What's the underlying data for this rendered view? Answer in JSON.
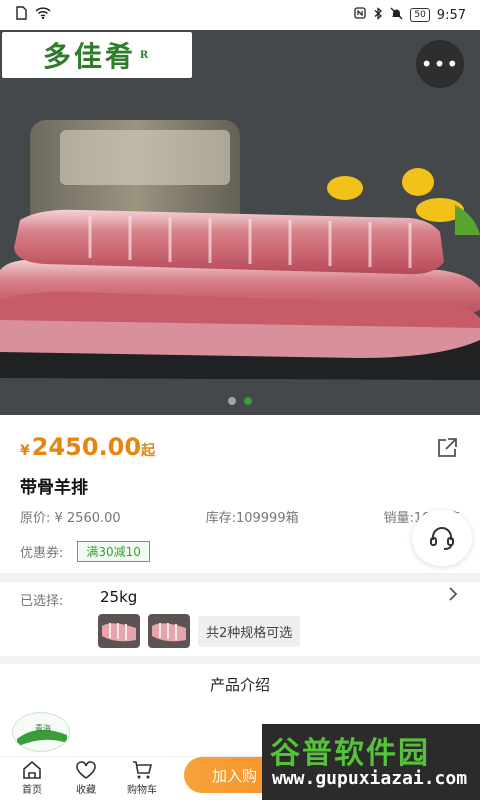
{
  "status_bar": {
    "time": "9:57",
    "battery": "50",
    "icons": [
      "sim-icon",
      "wifi-icon",
      "nfc-icon",
      "bluetooth-icon",
      "mute-icon"
    ]
  },
  "hero": {
    "logo_text": "多佳肴",
    "logo_mark": "R",
    "dots": 2,
    "active_dot": 1
  },
  "product": {
    "currency": "¥",
    "price": "2450.00",
    "price_suffix": "起",
    "title": "带骨羊排",
    "original_price": "原价: ¥ 2560.00",
    "stock": "库存:109999箱",
    "sales": "销量:1001箱",
    "coupon_label": "优惠券:",
    "coupon": "满30减10"
  },
  "selection": {
    "label": "已选择:",
    "value": "25kg",
    "spec_chip": "共2种规格可选"
  },
  "intro": {
    "title": "产品介绍",
    "logo_text": "青海"
  },
  "bottom_bar": {
    "tabs": [
      {
        "label": "首页",
        "icon": "home-icon"
      },
      {
        "label": "收藏",
        "icon": "heart-icon"
      },
      {
        "label": "购物车",
        "icon": "cart-icon"
      }
    ],
    "add_to_cart": "加入购"
  },
  "watermark": {
    "title": "谷普软件园",
    "url": "www.gupuxiazai.com"
  },
  "colors": {
    "price": "#e4860f",
    "accent_green": "#3a9d3a",
    "cart_button": "#f38a1c"
  }
}
